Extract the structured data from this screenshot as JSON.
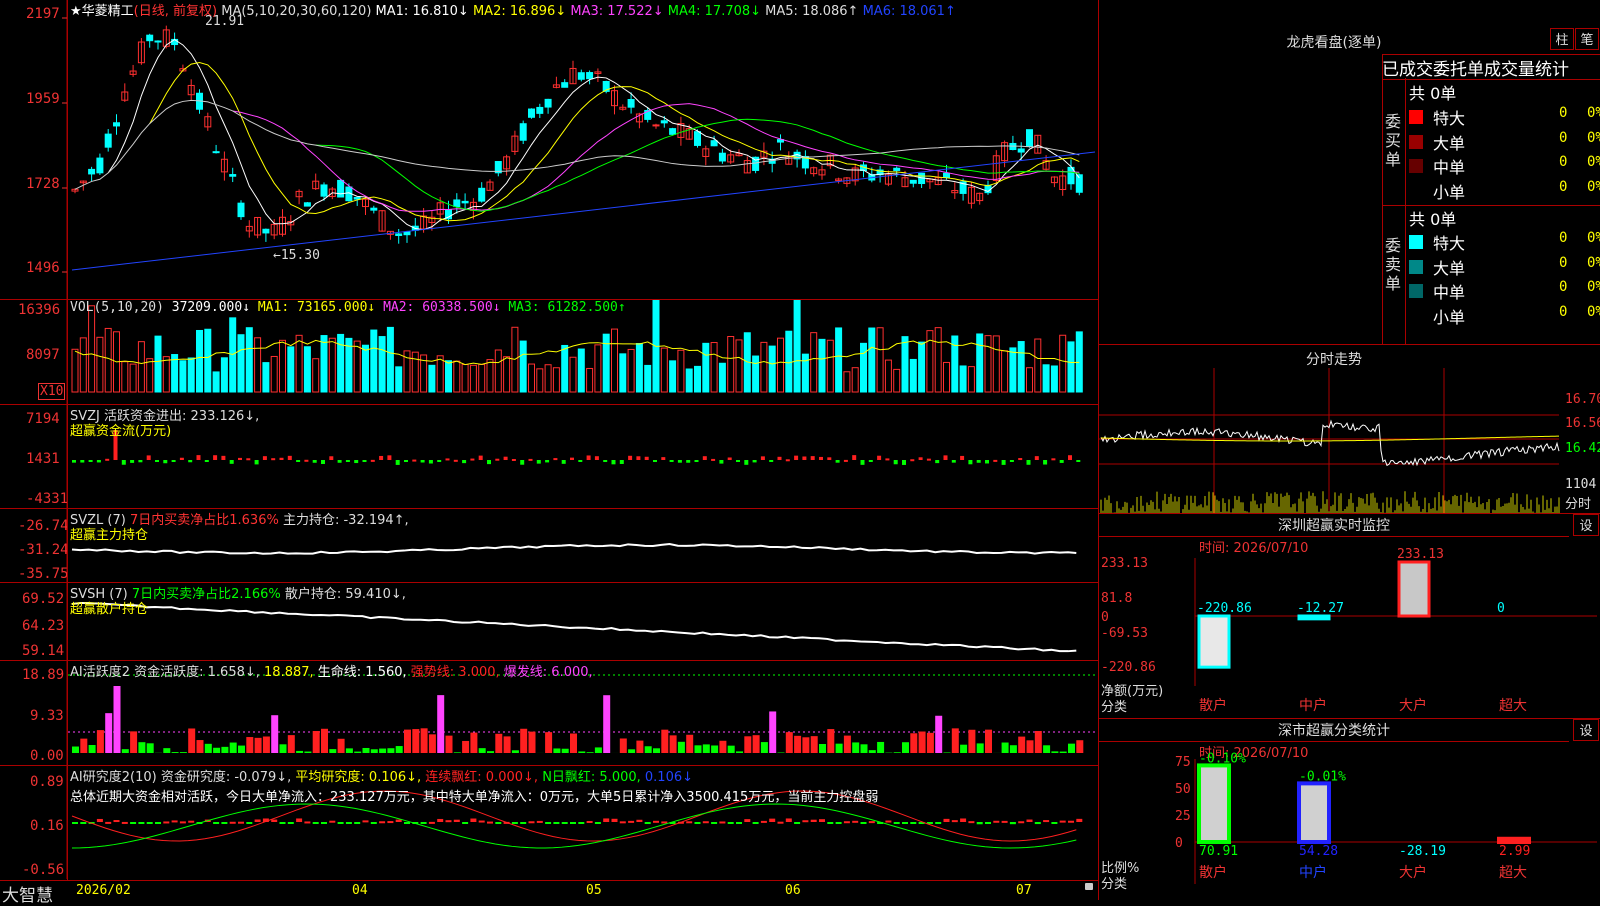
{
  "stock": {
    "name": "华菱精工",
    "period": "(日线, 前复权)",
    "star": "★"
  },
  "ma_line": [
    {
      "label": "MA(5,10,20,30,60,120)",
      "color": "#dddddd"
    },
    {
      "label": "MA1: 16.810↓",
      "color": "#ffffff"
    },
    {
      "label": "MA2: 16.896↓",
      "color": "#ffff00"
    },
    {
      "label": "MA3: 17.522↓",
      "color": "#ff44ff"
    },
    {
      "label": "MA4: 17.708↓",
      "color": "#00ff00"
    },
    {
      "label": "MA5: 18.086↑",
      "color": "#dddddd"
    },
    {
      "label": "MA6: 18.061↑",
      "color": "#2244ff"
    }
  ],
  "main_axis": [
    "2197",
    "1959",
    "1728",
    "1496"
  ],
  "annot_high": "21.91",
  "annot_low": "←15.30",
  "vol": {
    "axis": [
      "16396",
      "8097"
    ],
    "unit": "X10",
    "info": [
      {
        "label": "VOL(5,10,20)",
        "color": "#dddddd"
      },
      {
        "label": "37209.000↓",
        "color": "#ffffff"
      },
      {
        "label": "MA1: 73165.000↓",
        "color": "#ffff00"
      },
      {
        "label": "MA2: 60338.500↓",
        "color": "#ff44ff"
      },
      {
        "label": "MA3: 61282.500↑",
        "color": "#00ff00"
      }
    ]
  },
  "svzj": {
    "axis": [
      "7194",
      "1431",
      "-4331"
    ],
    "info": "SVZJ  活跃资金进出: 233.126↓,",
    "sub": "超赢资金流(万元)"
  },
  "svzl": {
    "axis": [
      "-26.74",
      "-31.24",
      "-35.75"
    ],
    "info1": "SVZL (7)",
    "info2": "7日内买卖净占比1.636%",
    "info3": "主力持仓: -32.194↑,",
    "sub": "超赢主力持仓"
  },
  "svsh": {
    "axis": [
      "69.52",
      "64.23",
      "59.14"
    ],
    "info1": "SVSH (7)",
    "info2": "7日内买卖净占比2.166%",
    "info3": "散户持仓: 59.410↓,",
    "sub": "超赢散户持仓"
  },
  "ai1": {
    "axis": [
      "18.89",
      "9.33",
      "0.00"
    ],
    "info": [
      {
        "label": "AI活跃度2 资金活跃度: 1.658↓,",
        "color": "#dddddd"
      },
      {
        "label": "18.887,",
        "color": "#ffff00"
      },
      {
        "label": "生命线: 1.560,",
        "color": "#ffffff"
      },
      {
        "label": "强势线: 3.000,",
        "color": "#ff2222"
      },
      {
        "label": "爆发线: 6.000,",
        "color": "#ff44ff"
      }
    ]
  },
  "ai2": {
    "axis": [
      "0.89",
      "0.16",
      "-0.56"
    ],
    "info": [
      {
        "label": "AI研究度2(10) 资金研究度: -0.079↓,",
        "color": "#dddddd"
      },
      {
        "label": "平均研究度: 0.106↓,",
        "color": "#ffff00"
      },
      {
        "label": "连续飘红: 0.000↓,",
        "color": "#ff2222"
      },
      {
        "label": "N日飘红: 5.000,",
        "color": "#00ff00"
      },
      {
        "label": "0.106↓",
        "color": "#2244ff"
      }
    ],
    "summary": "总体近期大资金相对活跃，今日大单净流入：233.127万元，其中特大单净流入：0万元，大单5日累计净入3500.415万元，当前主力控盘弱"
  },
  "date_axis": {
    "app": "大智慧",
    "labels": [
      "2026/02",
      "04",
      "05",
      "06",
      "07"
    ]
  },
  "dragon": {
    "title": "龙虎看盘(逐单)",
    "btn1": "柱",
    "btn2": "笔",
    "tabs": "已成交委托单成交量统计",
    "buy_label": "委买单",
    "buy_total": "共 0单",
    "sell_label": "委卖单",
    "sell_total": "共 0单",
    "buy_rows": [
      {
        "name": "特大",
        "v": "0",
        "p": "0%",
        "c": "#ff0000"
      },
      {
        "name": "大单",
        "v": "0",
        "p": "0%",
        "c": "#990000"
      },
      {
        "name": "中单",
        "v": "0",
        "p": "0%",
        "c": "#660000"
      },
      {
        "name": "小单",
        "v": "0",
        "p": "0%",
        "c": "#000000"
      }
    ],
    "sell_rows": [
      {
        "name": "特大",
        "v": "0",
        "p": "0%",
        "c": "#00ffff"
      },
      {
        "name": "大单",
        "v": "0",
        "p": "0%",
        "c": "#008888"
      },
      {
        "name": "中单",
        "v": "0",
        "p": "0%",
        "c": "#006666"
      },
      {
        "name": "小单",
        "v": "0",
        "p": "0%",
        "c": "#000000"
      }
    ]
  },
  "intraday": {
    "title": "分时走势",
    "prices": [
      "16.70",
      "16.56",
      "16.42"
    ],
    "vol": "1104",
    "vol_label": "分时"
  },
  "monitor": {
    "title": "深圳超赢实时监控",
    "btn": "设",
    "time": "时间: 2026/07/10",
    "axis": [
      "233.13",
      "81.8",
      "0",
      "-69.53",
      "-220.86"
    ],
    "unit": "净额(万元)",
    "cat": "分类",
    "bars": [
      {
        "name": "散户",
        "value": -220.86,
        "label": "-220.86"
      },
      {
        "name": "中户",
        "value": -12.27,
        "label": "-12.27"
      },
      {
        "name": "大户",
        "value": 233.13,
        "label": "233.13"
      },
      {
        "name": "超大",
        "value": 0,
        "label": "0"
      }
    ]
  },
  "stats": {
    "title": "深市超赢分类统计",
    "btn": "设",
    "time": "时间: 2026/07/10",
    "axis": [
      "75",
      "50",
      "25",
      "0"
    ],
    "unit": "比例%",
    "cat": "分类",
    "bars": [
      {
        "name": "散户",
        "top": "-0.10%",
        "bottom": "70.91",
        "value": 70.91
      },
      {
        "name": "中户",
        "top": "-0.01%",
        "bottom": "54.28",
        "value": 54.28
      },
      {
        "name": "大户",
        "top": "",
        "bottom": "-28.19",
        "value": -28.19
      },
      {
        "name": "超大",
        "top": "",
        "bottom": "2.99",
        "value": 2.99
      }
    ]
  }
}
